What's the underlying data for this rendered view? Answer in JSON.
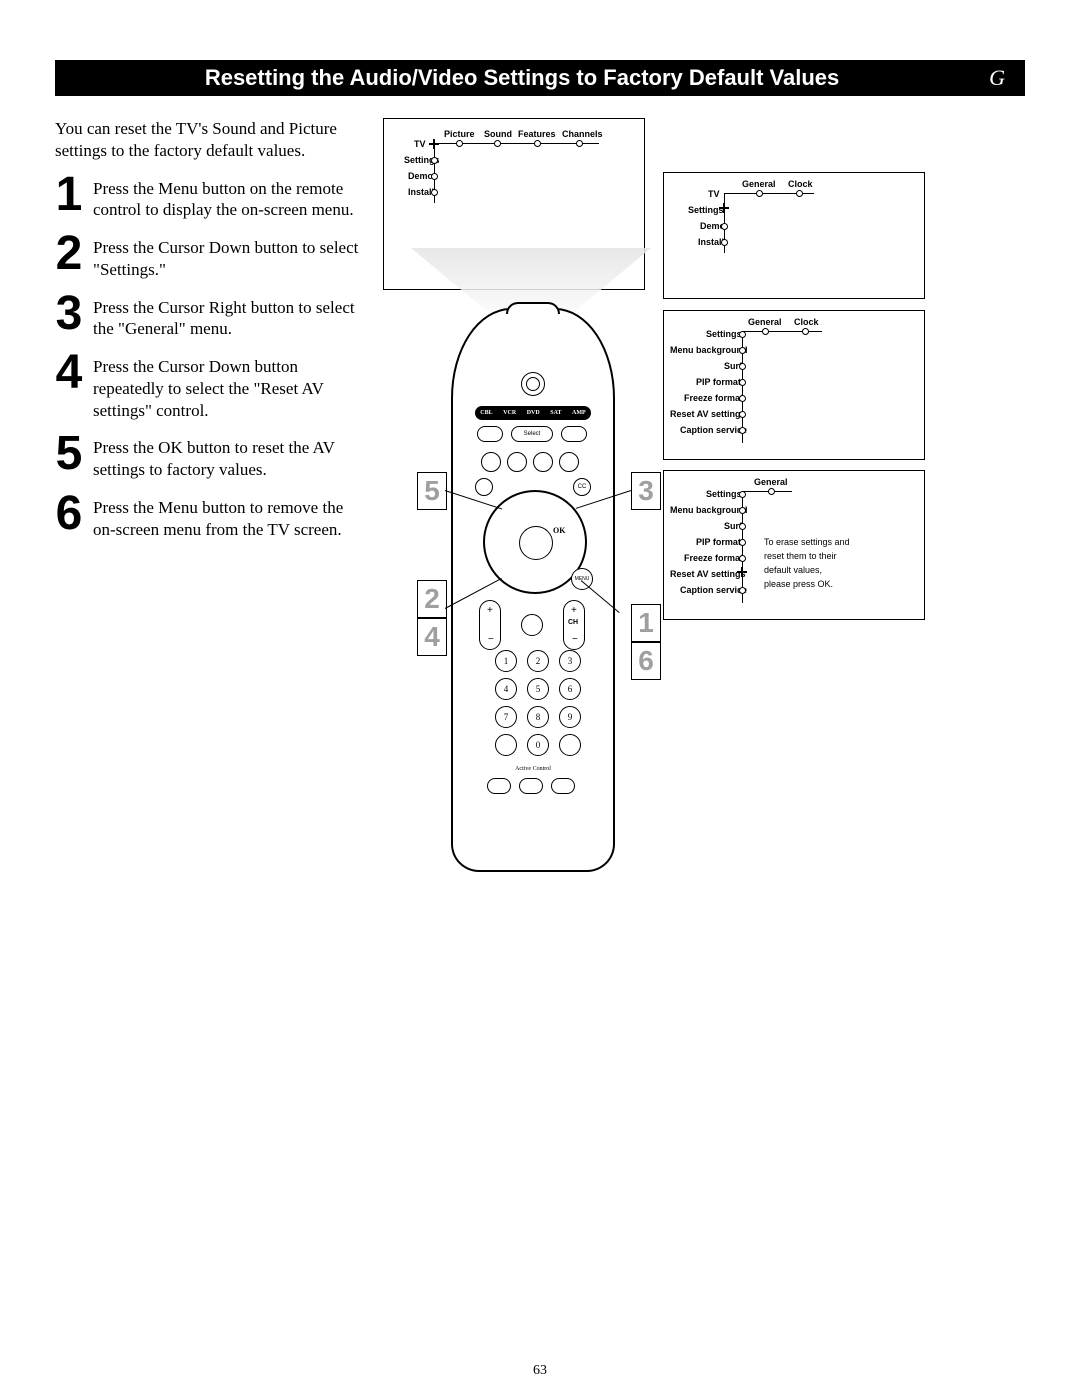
{
  "header": {
    "title": "Resetting the Audio/Video Settings to Factory Default Values",
    "page_letter": "G"
  },
  "intro": "You can reset the TV's Sound and Picture settings to the factory default values.",
  "steps": [
    {
      "num": "1",
      "text": "Press the Menu button on the remote control to display the on-screen menu."
    },
    {
      "num": "2",
      "text": "Press the Cursor Down button to select \"Settings.\""
    },
    {
      "num": "3",
      "text": "Press the Cursor Right button to select the \"General\" menu."
    },
    {
      "num": "4",
      "text": "Press the Cursor Down button repeatedly to select the \"Reset AV settings\" control."
    },
    {
      "num": "5",
      "text": "Press the OK button to reset the AV settings to factory values."
    },
    {
      "num": "6",
      "text": "Press the Menu button to remove the on-screen menu from the TV screen."
    }
  ],
  "remote": {
    "device_bar": [
      "CBL",
      "VCR",
      "DVD",
      "SAT",
      "AMP"
    ],
    "select_label": "Select",
    "ok_label": "OK",
    "menu_label": "MENU",
    "ch_label": "CH",
    "cc_label": "CC",
    "active_control": "Active Control",
    "keypad": [
      "1",
      "2",
      "3",
      "4",
      "5",
      "6",
      "7",
      "8",
      "9",
      "",
      "0",
      ""
    ]
  },
  "callouts": {
    "c1": "1",
    "c2": "2",
    "c3": "3",
    "c4": "4",
    "c5": "5",
    "c6": "6"
  },
  "screen1": {
    "top_row": [
      "Picture",
      "Sound",
      "Features",
      "Channels"
    ],
    "left_col_top": "TV",
    "left_col": [
      "Settings",
      "Demo",
      "Install"
    ]
  },
  "screen2": {
    "top_row": [
      "General",
      "Clock"
    ],
    "left_col_top": "TV",
    "left_col": [
      "Settings",
      "Demo",
      "Install"
    ]
  },
  "screen3": {
    "top_row": [
      "General",
      "Clock"
    ],
    "left_col": [
      "Settings",
      "Menu background",
      "Surf",
      "PIP format",
      "Freeze format",
      "Reset AV settings",
      "Caption service"
    ]
  },
  "screen4": {
    "top_row": [
      "General"
    ],
    "left_col": [
      "Settings",
      "Menu background",
      "Surf",
      "PIP format",
      "Freeze format",
      "Reset AV settings",
      "Caption service"
    ],
    "msg": [
      "To erase settings and",
      "reset them to their",
      "default values,",
      "please press OK."
    ]
  },
  "page_number": "63"
}
